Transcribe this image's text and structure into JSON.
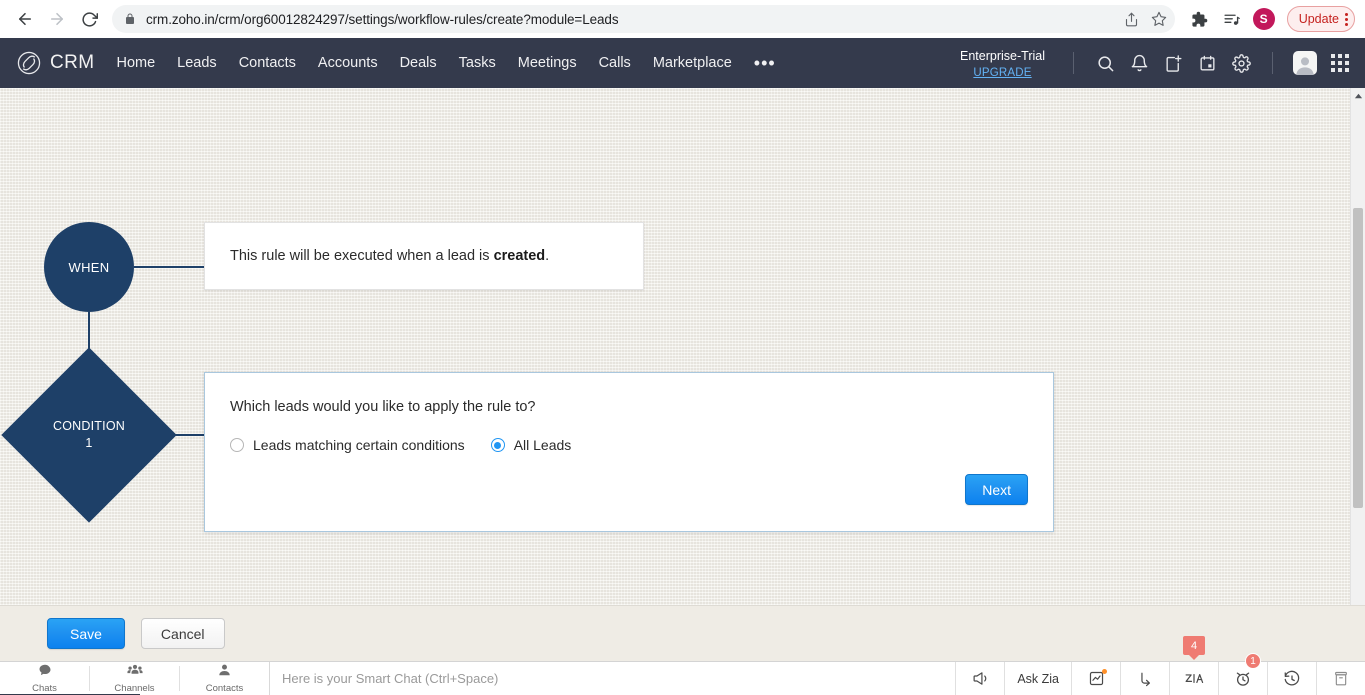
{
  "browser": {
    "url": "crm.zoho.in/crm/org60012824297/settings/workflow-rules/create?module=Leads",
    "back_label": "Back",
    "forward_label": "Forward",
    "reload_label": "Reload",
    "lock_label": "View site information",
    "share_label": "Share this page",
    "bookmark_label": "Bookmark this tab",
    "extensions_label": "Extensions",
    "reading_list_label": "Reading list",
    "profile_initial": "S",
    "update_label": "Update",
    "menu_label": "Customize and control"
  },
  "crm_header": {
    "logo_text": "CRM",
    "nav": [
      {
        "label": "Home"
      },
      {
        "label": "Leads"
      },
      {
        "label": "Contacts"
      },
      {
        "label": "Accounts"
      },
      {
        "label": "Deals"
      },
      {
        "label": "Tasks"
      },
      {
        "label": "Meetings"
      },
      {
        "label": "Calls"
      },
      {
        "label": "Marketplace"
      }
    ],
    "more_label": "•••",
    "plan": "Enterprise-Trial",
    "upgrade": "UPGRADE",
    "icons": [
      {
        "name": "search-icon",
        "label": "Search"
      },
      {
        "name": "bell-icon",
        "label": "Notifications"
      },
      {
        "name": "add-note-icon",
        "label": "Add"
      },
      {
        "name": "calendar-icon",
        "label": "Calendar"
      },
      {
        "name": "gear-icon",
        "label": "Setup"
      }
    ],
    "avatar_label": "User profile",
    "apps_label": "Zoho apps"
  },
  "flow": {
    "when_node": "WHEN",
    "condition_node_line1": "CONDITION",
    "condition_node_line2": "1"
  },
  "when_card": {
    "text_before": "This rule will be executed when a lead is ",
    "text_bold": "created",
    "text_after": "."
  },
  "condition_card": {
    "question": "Which leads would you like to apply the rule to?",
    "options": [
      {
        "label": "Leads matching certain conditions",
        "selected": false
      },
      {
        "label": "All Leads",
        "selected": true
      }
    ],
    "next_label": "Next"
  },
  "action_bar": {
    "save_label": "Save",
    "cancel_label": "Cancel"
  },
  "taskbar": {
    "left_items": [
      {
        "label": "Chats",
        "icon": "chat-bubble-icon"
      },
      {
        "label": "Channels",
        "icon": "group-icon"
      },
      {
        "label": "Contacts",
        "icon": "person-icon"
      }
    ],
    "smart_chat_placeholder": "Here is your Smart Chat (Ctrl+Space)",
    "right_items": [
      {
        "name": "megaphone-icon",
        "label": "",
        "badge": ""
      },
      {
        "name": "ask-zia-button",
        "label": "Ask Zia",
        "badge": ""
      },
      {
        "name": "analytics-icon",
        "label": "",
        "badge": ""
      },
      {
        "name": "share-arrow-icon",
        "label": "",
        "badge": ""
      },
      {
        "name": "zia-icon",
        "label": "",
        "badge": "4"
      },
      {
        "name": "alarm-clock-icon",
        "label": "",
        "badge": "1"
      },
      {
        "name": "history-icon",
        "label": "",
        "badge": ""
      },
      {
        "name": "archive-icon",
        "label": "",
        "badge": ""
      }
    ]
  },
  "colors": {
    "header_bg": "#343a4c",
    "node_navy": "#1e4068",
    "accent_blue": "#2196f3",
    "canvas_bg": "#efece5",
    "badge_coral": "#ef7b72",
    "update_red": "#c5221f",
    "avatar_magenta": "#c2185b"
  }
}
